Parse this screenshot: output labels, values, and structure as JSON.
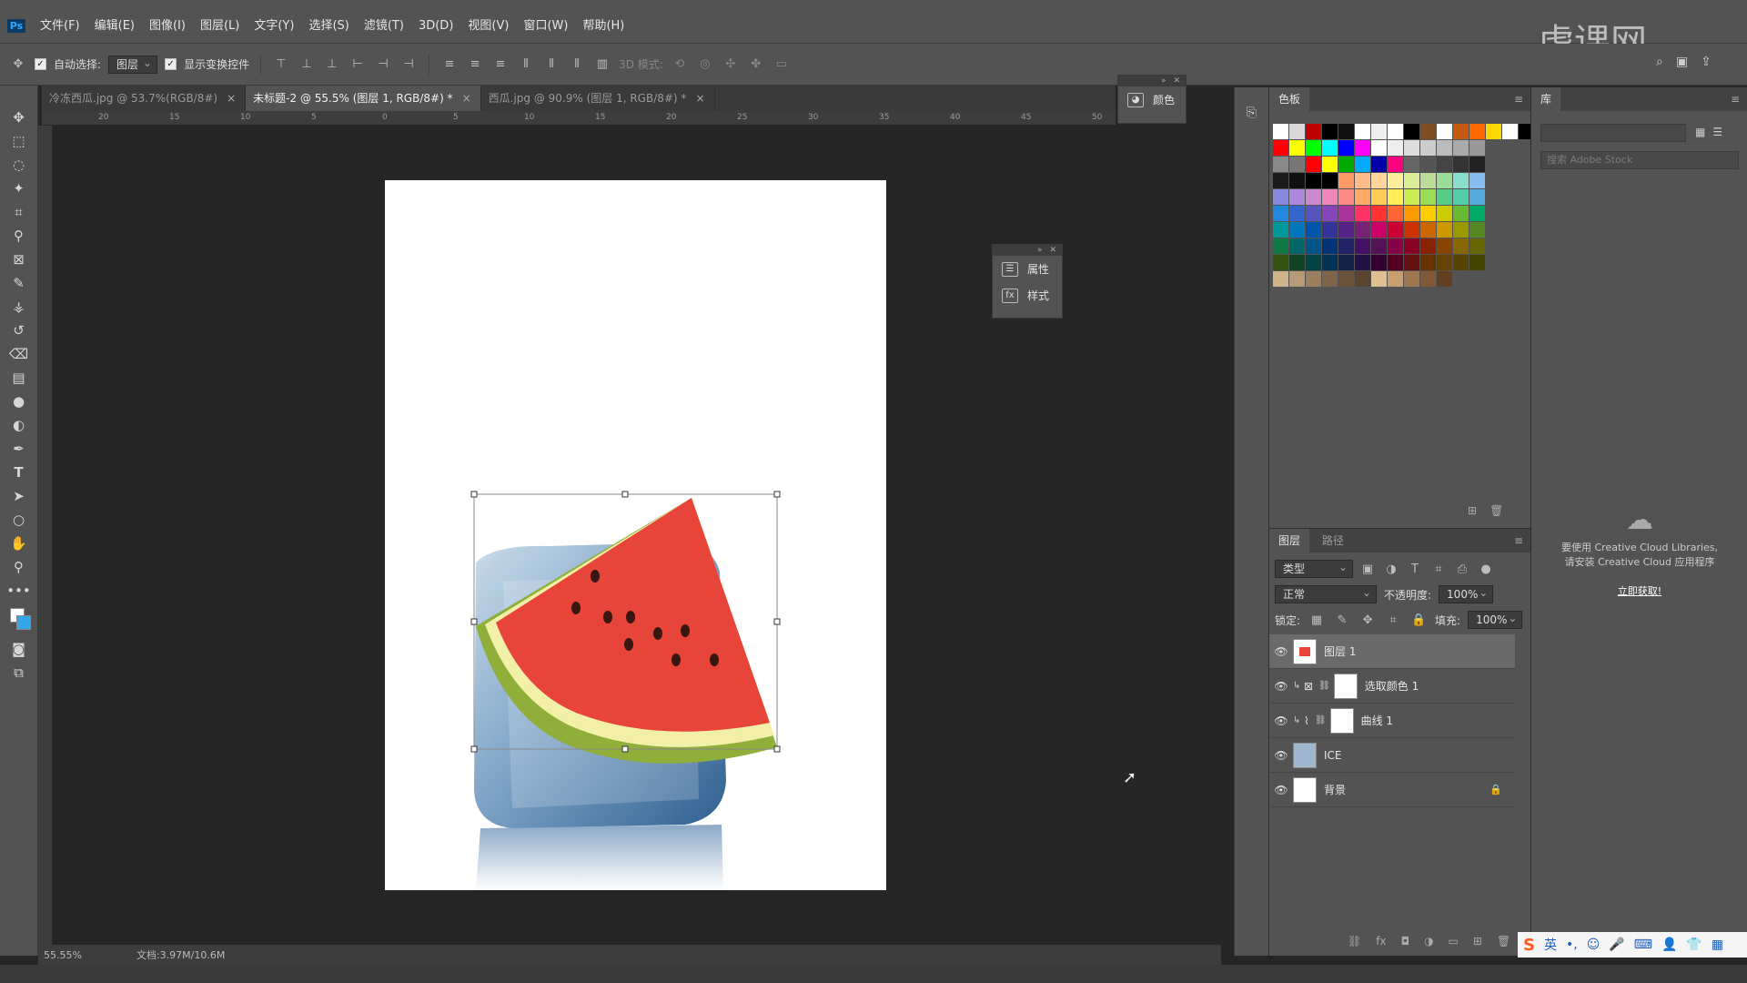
{
  "app": {
    "logo": "Ps"
  },
  "menu": [
    "文件(F)",
    "编辑(E)",
    "图像(I)",
    "图层(L)",
    "文字(Y)",
    "选择(S)",
    "滤镜(T)",
    "3D(D)",
    "视图(V)",
    "窗口(W)",
    "帮助(H)"
  ],
  "options": {
    "auto_select_label": "自动选择:",
    "auto_select_value": "图层",
    "show_transform_label": "显示变换控件",
    "mode3d_label": "3D 模式:"
  },
  "tabs": [
    {
      "label": "冷冻西瓜.jpg @ 53.7%(RGB/8#)",
      "close": "×"
    },
    {
      "label": "未标题-2 @ 55.5% (图层 1, RGB/8#) *",
      "close": "×"
    },
    {
      "label": "西瓜.jpg @ 90.9% (图层 1, RGB/8#) *",
      "close": "×"
    }
  ],
  "ruler_top": [
    "20",
    "15",
    "10",
    "5",
    "0",
    "5",
    "10",
    "15",
    "20",
    "25",
    "30",
    "35",
    "40",
    "45",
    "50"
  ],
  "status": {
    "zoom": "55.55%",
    "doc": "文档:3.97M/10.6M"
  },
  "float_color": {
    "label": "颜色"
  },
  "float_props": {
    "properties": "属性",
    "styles": "样式"
  },
  "swatches_panel": {
    "title": "色板"
  },
  "swatch_colors": [
    [
      "#ffffff",
      "#d9d9d9",
      "#c00000",
      "#000000",
      "#111111",
      "#ffffff",
      "#eeeeee",
      "#ffffff",
      "#000000",
      "#7f4f21",
      "#ffffff",
      "#c55a11",
      "#ff6600",
      "#ffd700",
      "#ffffff",
      "#000000",
      "#ffffff"
    ],
    [
      "#ff0000",
      "#ffff00",
      "#00ff00",
      "#00ffff",
      "#0000ff",
      "#ff00ff",
      "#ffffff",
      "#eeeeee",
      "#dddddd",
      "#cccccc",
      "#bbbbbb",
      "#aaaaaa",
      "#999999"
    ],
    [
      "#888888",
      "#777777",
      "#ff0000",
      "#ffff00",
      "#00aa00",
      "#00aaff",
      "#0000aa",
      "#ff0080",
      "#666666",
      "#555555",
      "#444444",
      "#333333",
      "#222222"
    ],
    [
      "#1a1a1a",
      "#111111",
      "#000000",
      "#000000",
      "#ff9966",
      "#ffbb88",
      "#ffd699",
      "#ffee99",
      "#ddee99",
      "#bbdd99",
      "#99dd99",
      "#88ddcc",
      "#88bbee"
    ],
    [
      "#8888dd",
      "#aa88dd",
      "#cc88cc",
      "#ee88bb",
      "#ff8888",
      "#ffaa66",
      "#ffcc55",
      "#ffee55",
      "#ccee55",
      "#99dd55",
      "#55cc88",
      "#55ccaa",
      "#55aadd"
    ],
    [
      "#2288dd",
      "#3366cc",
      "#5555bb",
      "#8844bb",
      "#aa3399",
      "#ff3366",
      "#ff3333",
      "#ff6633",
      "#ff9900",
      "#ffcc00",
      "#cccc00",
      "#66bb33",
      "#00aa66"
    ],
    [
      "#009999",
      "#0077bb",
      "#0055aa",
      "#333399",
      "#552288",
      "#772277",
      "#cc0066",
      "#cc0033",
      "#cc3300",
      "#cc6600",
      "#cc9900",
      "#999900",
      "#558822"
    ],
    [
      "#117744",
      "#006666",
      "#005588",
      "#003377",
      "#222266",
      "#441166",
      "#551155",
      "#880044",
      "#880022",
      "#882200",
      "#884400",
      "#886600",
      "#666600"
    ],
    [
      "#335511",
      "#114422",
      "#004444",
      "#003355",
      "#112244",
      "#221144",
      "#330033",
      "#550022",
      "#661111",
      "#663300",
      "#664400",
      "#554400",
      "#444400"
    ],
    [
      "#d2b48c",
      "#b89a76",
      "#9b7f5f",
      "#7f6549",
      "#6b5238",
      "#5a4430",
      "#e0c090",
      "#c8a070",
      "#a07850",
      "#805a38",
      "#604020"
    ]
  ],
  "layers_panel": {
    "tabs": [
      "图层",
      "路径"
    ],
    "filter_kind": "类型",
    "blend_mode": "正常",
    "opacity_label": "不透明度:",
    "opacity_value": "100%",
    "lock_label": "锁定:",
    "fill_label": "填充:",
    "fill_value": "100%",
    "layers": [
      {
        "name": "图层 1",
        "selected": true
      },
      {
        "name": "选取颜色 1",
        "selected": false
      },
      {
        "name": "曲线 1",
        "selected": false
      },
      {
        "name": "ICE",
        "selected": false
      },
      {
        "name": "背景",
        "selected": false
      }
    ]
  },
  "library_panel": {
    "title": "库",
    "search_placeholder": "搜索 Adobe Stock",
    "message_line1": "要使用 Creative Cloud Libraries,",
    "message_line2": "请安装 Creative Cloud 应用程序",
    "install_link": "立即获取!"
  },
  "watermark": "虎课网",
  "ime_bar": {
    "lang": "英"
  }
}
